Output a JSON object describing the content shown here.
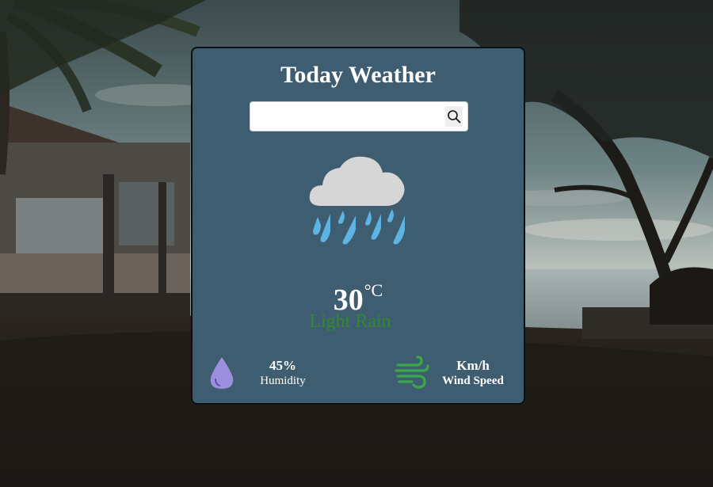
{
  "background": {
    "scene": "beach-palm-trees-dusk"
  },
  "card": {
    "background_color": "#3f5d70",
    "title": "Today Weather",
    "search": {
      "value": "",
      "placeholder": "",
      "icon": "search-icon"
    },
    "weather": {
      "icon": "cloud-rain-icon",
      "temperature": "30",
      "unit": "°C",
      "description": "Light Rain",
      "description_color": "#2f8a2f"
    },
    "stats": {
      "humidity": {
        "icon": "water-drop-icon",
        "icon_color": "#9d8fe0",
        "value": "45%",
        "label": "Humidity"
      },
      "wind": {
        "icon": "wind-icon",
        "icon_color": "#3aa84a",
        "value": "Km/h",
        "label": "Wind Speed"
      }
    }
  }
}
